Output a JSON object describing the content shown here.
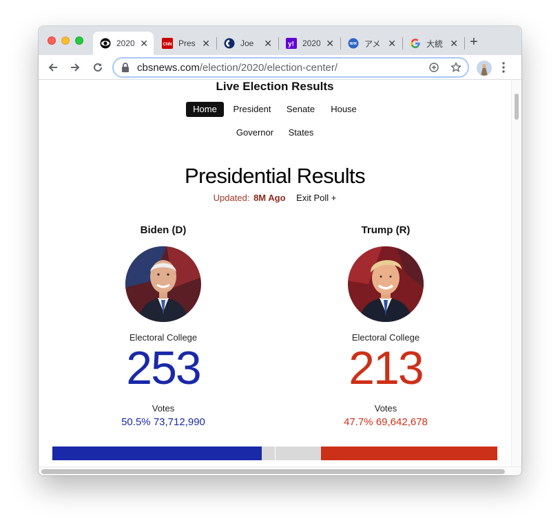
{
  "browser": {
    "tabs": [
      {
        "title": "2020",
        "icon": "cbs-eye-icon"
      },
      {
        "title": "Pres",
        "icon": "cnn-logo-icon"
      },
      {
        "title": "Joe",
        "icon": "site-logo-icon"
      },
      {
        "title": "2020",
        "icon": "yahoo-logo-icon"
      },
      {
        "title": "アメ",
        "icon": "nhk-logo-icon"
      },
      {
        "title": "大統",
        "icon": "google-logo-icon"
      }
    ],
    "url_host": "cbsnews.com",
    "url_path": "/election/2020/election-center/"
  },
  "page": {
    "title": "Live Election Results",
    "nav": [
      "Home",
      "President",
      "Senate",
      "House",
      "Governor",
      "States"
    ],
    "active_nav": "Home",
    "heading": "Presidential Results",
    "updated_label": "Updated:",
    "updated_time": "8M Ago",
    "exit_poll": "Exit Poll +"
  },
  "candidates": [
    {
      "name": "Biden (D)",
      "ec_label": "Electoral College",
      "electoral_votes": "253",
      "votes_label": "Votes",
      "vote_pct": "50.5%",
      "vote_count": "73,712,990",
      "color": "#1a29a8"
    },
    {
      "name": "Trump (R)",
      "ec_label": "Electoral College",
      "electoral_votes": "213",
      "votes_label": "Votes",
      "vote_pct": "47.7%",
      "vote_count": "69,642,678",
      "color": "#cc3018"
    }
  ],
  "colors": {
    "dem": "#1a29a8",
    "rep": "#cc3018",
    "uncalled": "#d9d9d9"
  }
}
